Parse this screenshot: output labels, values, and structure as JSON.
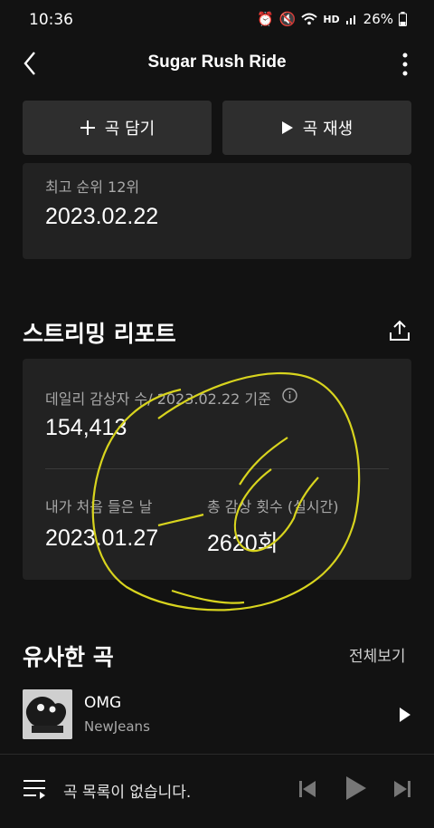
{
  "status": {
    "time": "10:36",
    "battery": "26%",
    "network": "HD"
  },
  "header": {
    "title": "Sugar Rush Ride"
  },
  "actions": {
    "add_label": "곡 담기",
    "play_label": "곡 재생"
  },
  "chart_info": {
    "peak_label": "최고 순위 12위",
    "date": "2023.02.22"
  },
  "report": {
    "title": "스트리밍 리포트",
    "daily_label": "데일리 감상자 수/ 2023.02.22 기준",
    "daily_value": "154,413",
    "first_listen_label": "내가 처음 들은 날",
    "first_listen_value": "2023.01.27",
    "total_label": "총 감상 횟수 (실시간)",
    "total_value": "2620회"
  },
  "similar": {
    "title": "유사한 곡",
    "see_all": "전체보기",
    "items": [
      {
        "title": "OMG",
        "artist": "NewJeans"
      }
    ]
  },
  "player": {
    "empty_text": "곡 목록이 없습니다."
  }
}
